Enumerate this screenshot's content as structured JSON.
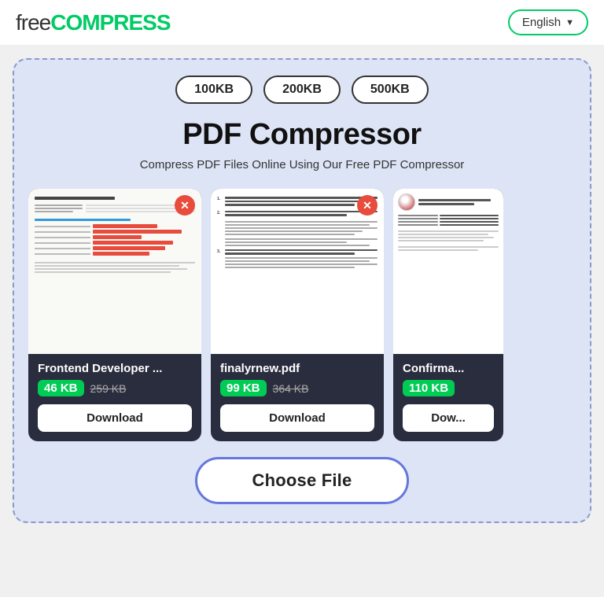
{
  "header": {
    "logo_free": "free",
    "logo_compress": "COMPRESS",
    "lang_label": "English",
    "lang_chevron": "▼"
  },
  "compressor": {
    "size_presets": [
      "100KB",
      "200KB",
      "500KB"
    ],
    "title": "PDF Compressor",
    "subtitle": "Compress PDF Files Online Using Our Free PDF Compressor",
    "files": [
      {
        "name": "Frontend Developer ...",
        "size_new": "46 KB",
        "size_old": "259 KB",
        "download_label": "Download"
      },
      {
        "name": "finalyrnew.pdf",
        "size_new": "99 KB",
        "size_old": "364 KB",
        "download_label": "Download"
      },
      {
        "name": "Confirma...",
        "size_new": "110 KB",
        "size_old": "",
        "download_label": "Dow..."
      }
    ],
    "choose_file_label": "Choose File"
  }
}
